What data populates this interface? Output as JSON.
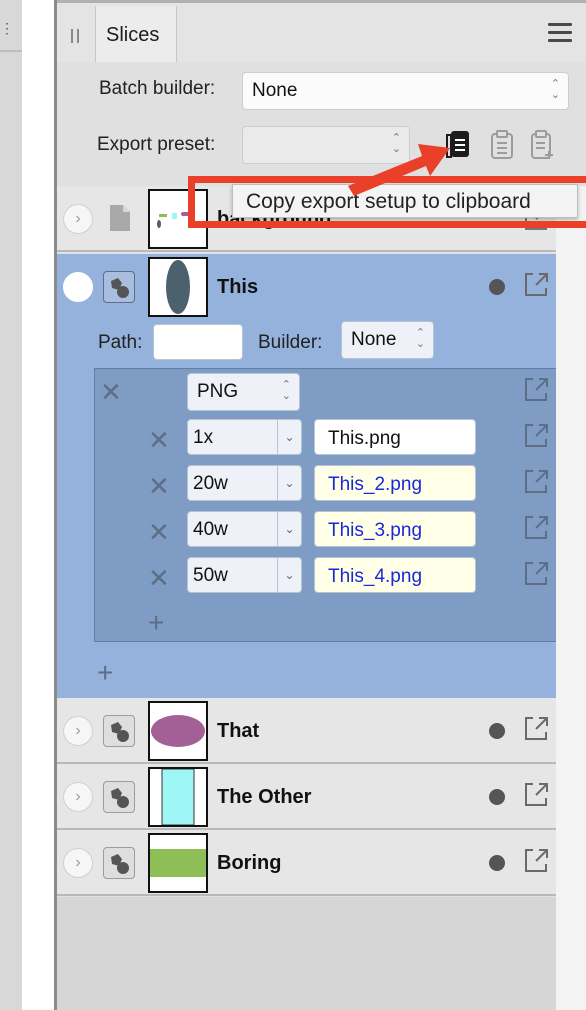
{
  "panel": {
    "tab_label": "Slices",
    "batch_builder": {
      "label": "Batch builder:",
      "value": "None"
    },
    "export_preset": {
      "label": "Export preset:",
      "value": ""
    },
    "tooltip": "Copy export setup to clipboard"
  },
  "slices": [
    {
      "name": "background",
      "expanded": false
    },
    {
      "name": "This",
      "expanded": true,
      "path_label": "Path:",
      "path_value": "",
      "builder_label": "Builder:",
      "builder_value": "None",
      "format": "PNG",
      "outputs": [
        {
          "size": "1x",
          "file": "This.png"
        },
        {
          "size": "20w",
          "file": "This_2.png"
        },
        {
          "size": "40w",
          "file": "This_3.png"
        },
        {
          "size": "50w",
          "file": "This_4.png"
        }
      ]
    },
    {
      "name": "That",
      "expanded": false
    },
    {
      "name": "The Other",
      "expanded": false
    },
    {
      "name": "Boring",
      "expanded": false
    }
  ],
  "icons": {
    "menu": "hamburger-menu-icon",
    "copy_setup": "copy-export-setup-icon",
    "paste_setup": "paste-export-setup-icon",
    "paste_new": "paste-new-setup-icon",
    "export": "export-arrow-icon",
    "add": "plus-icon",
    "remove": "x-icon"
  },
  "colors": {
    "selected_row": "#94b2db",
    "format_box": "#7e9cc4",
    "filename_link": "#1a28d8",
    "annotation_red": "#ea3f28",
    "that_thumb": "#a36097",
    "other_thumb": "#9ff7f5",
    "boring_thumb": "#8dbf56"
  }
}
